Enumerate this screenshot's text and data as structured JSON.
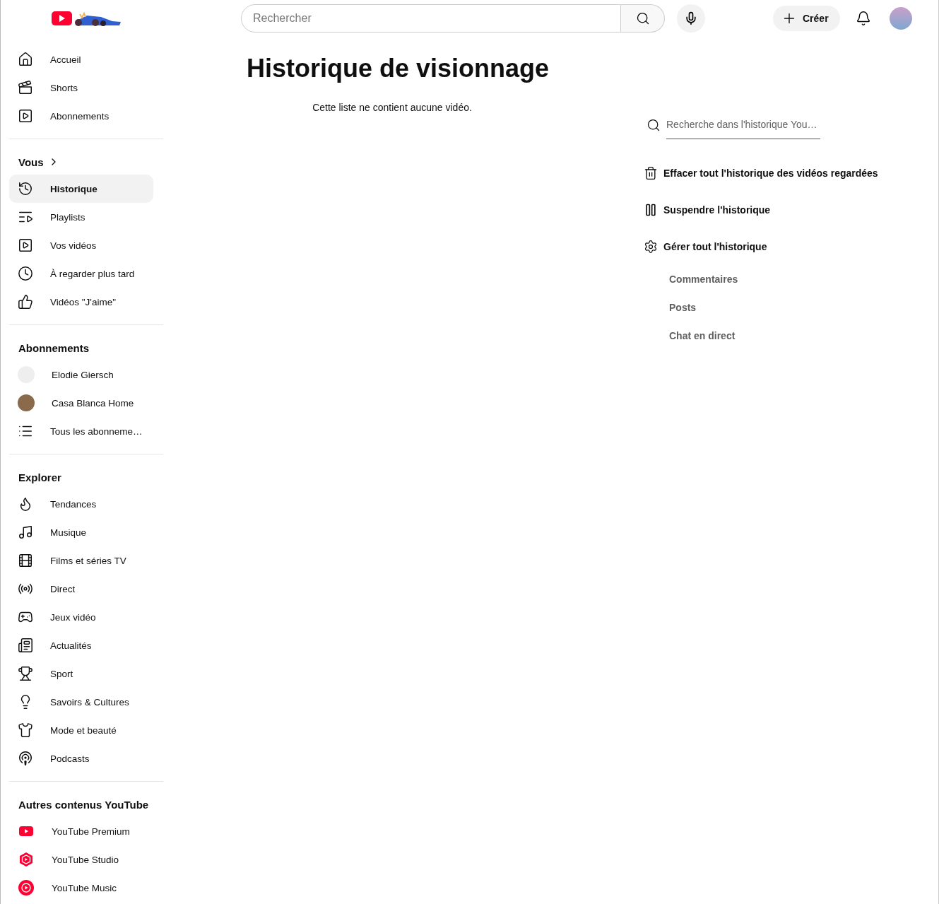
{
  "topbar": {
    "search": {
      "placeholder": "Rechercher"
    },
    "create_button": "Créer"
  },
  "sidebar": {
    "sections": [
      {
        "items": [
          {
            "label": "Accueil",
            "kind": "home",
            "selected": false
          },
          {
            "label": "Shorts",
            "kind": "shorts",
            "selected": false
          },
          {
            "label": "Abonnements",
            "kind": "subscriptions",
            "selected": false
          }
        ]
      },
      {
        "title": "Vous",
        "has_chevron": true,
        "items": [
          {
            "label": "Historique",
            "kind": "history",
            "selected": true
          },
          {
            "label": "Playlists",
            "kind": "playlists",
            "selected": false
          },
          {
            "label": "Vos vidéos",
            "kind": "videos",
            "selected": false
          },
          {
            "label": "À regarder plus tard",
            "kind": "later",
            "selected": false
          },
          {
            "label": "Vidéos \"J'aime\"",
            "kind": "liked",
            "selected": false
          }
        ]
      },
      {
        "title": "Abonnements",
        "items": [
          {
            "label": "Elodie Giersch",
            "kind": "channel-light",
            "selected": false
          },
          {
            "label": "Casa Blanca Home",
            "kind": "channel-dark",
            "selected": false
          },
          {
            "label": "Tous les abonneme…",
            "kind": "all",
            "selected": false
          }
        ]
      },
      {
        "title": "Explorer",
        "items": [
          {
            "label": "Tendances",
            "kind": "trending",
            "selected": false
          },
          {
            "label": "Musique",
            "kind": "music",
            "selected": false
          },
          {
            "label": "Films et séries TV",
            "kind": "films",
            "selected": false
          },
          {
            "label": "Direct",
            "kind": "live",
            "selected": false
          },
          {
            "label": "Jeux vidéo",
            "kind": "gaming",
            "selected": false
          },
          {
            "label": "Actualités",
            "kind": "news",
            "selected": false
          },
          {
            "label": "Sport",
            "kind": "sport",
            "selected": false
          },
          {
            "label": "Savoirs & Cultures",
            "kind": "learning",
            "selected": false
          },
          {
            "label": "Mode et beauté",
            "kind": "fashion",
            "selected": false
          },
          {
            "label": "Podcasts",
            "kind": "podcasts",
            "selected": false
          }
        ]
      },
      {
        "title": "Autres contenus YouTube",
        "items": [
          {
            "label": "YouTube Premium",
            "kind": "premium",
            "selected": false
          },
          {
            "label": "YouTube Studio",
            "kind": "studio",
            "selected": false
          },
          {
            "label": "YouTube Music",
            "kind": "ytmusic",
            "selected": false
          }
        ]
      }
    ]
  },
  "main": {
    "title": "Historique de visionnage",
    "empty_message": "Cette liste ne contient aucune vidéo.",
    "history_search": {
      "placeholder": "Recherche dans l'historique You…"
    },
    "actions": [
      {
        "label": "Effacer tout l'historique des vidéos regardées",
        "kind": "clear"
      },
      {
        "label": "Suspendre l'historique",
        "kind": "pause"
      },
      {
        "label": "Gérer tout l'historique",
        "kind": "manage"
      }
    ],
    "sub_links": [
      "Commentaires",
      "Posts",
      "Chat en direct"
    ]
  }
}
